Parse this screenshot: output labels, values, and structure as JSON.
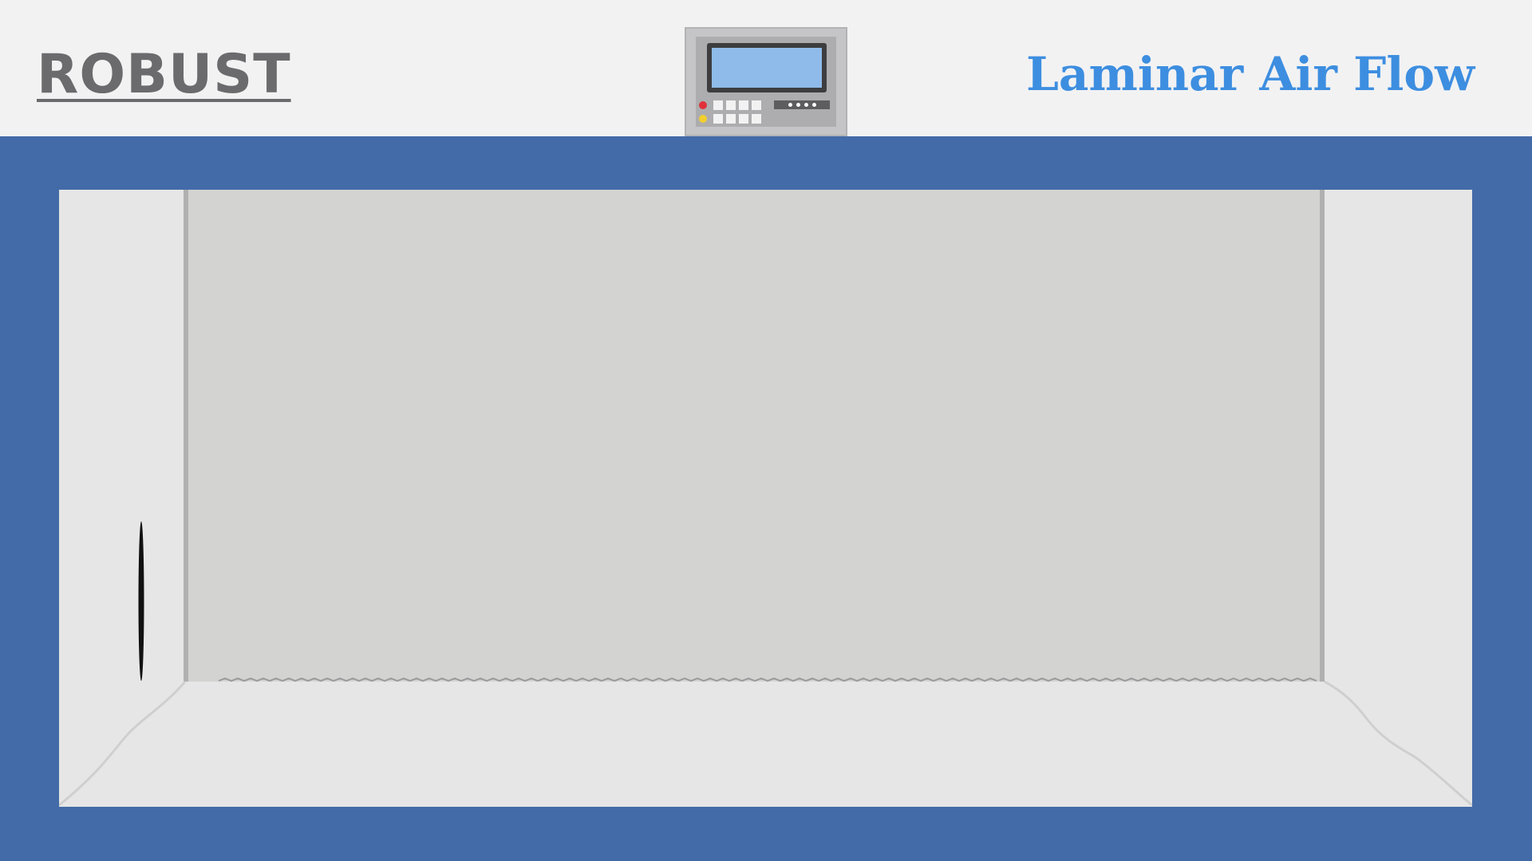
{
  "header": {
    "brand": "ROBUST",
    "product_title": "Laminar Air Flow"
  },
  "control_panel": {
    "indicators": [
      {
        "name": "red-indicator",
        "color": "#e0313a"
      },
      {
        "name": "yellow-indicator",
        "color": "#f2cf2e"
      }
    ],
    "display_color": "#8fbbea"
  },
  "colors": {
    "cabinet": "#436ba8",
    "chamber_floor": "#e6e6e6",
    "back_wall": "#d3d3d2",
    "brand": "#6b6b6e",
    "title": "#3d8ee0"
  },
  "icons": [
    "control-panel-icon",
    "handle-icon"
  ]
}
